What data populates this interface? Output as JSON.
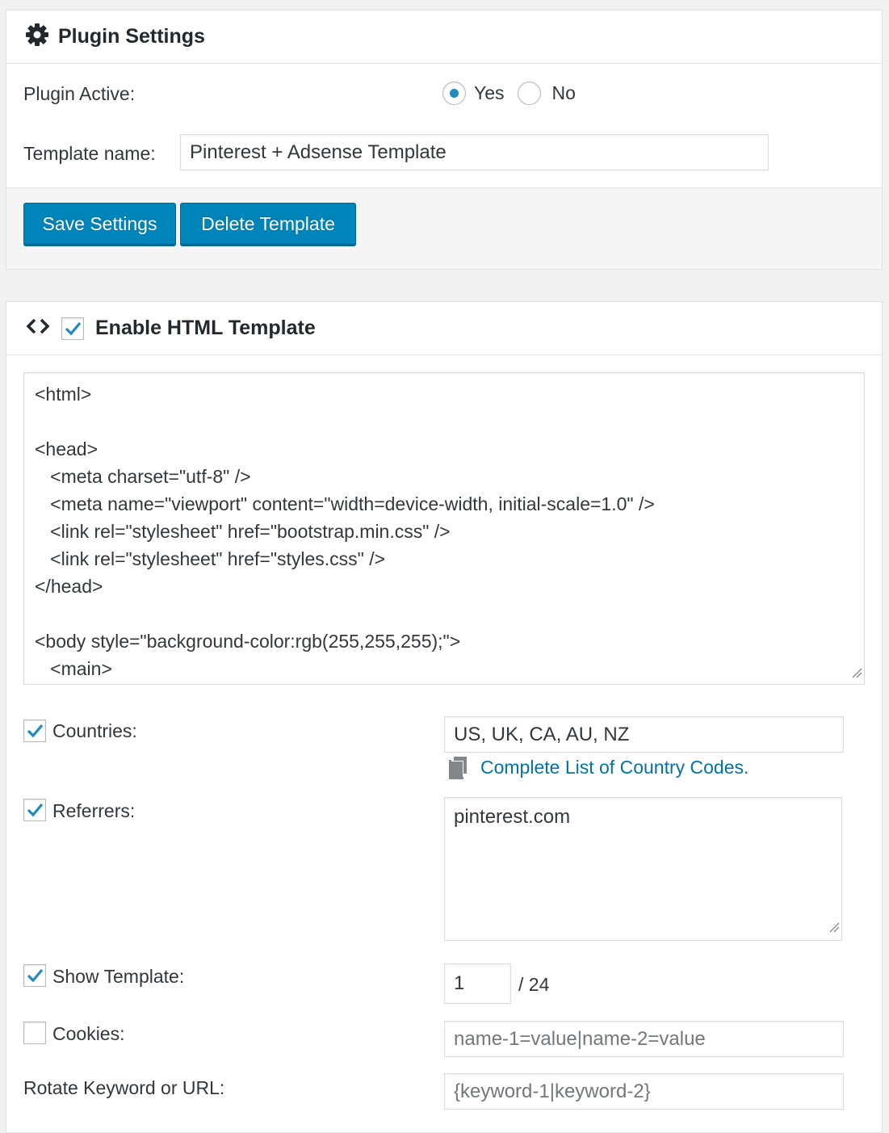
{
  "settings_panel": {
    "title": "Plugin Settings",
    "icon": "gear-icon",
    "plugin_active": {
      "label": "Plugin Active:",
      "options": [
        {
          "label": "Yes",
          "selected": true
        },
        {
          "label": "No",
          "selected": false
        }
      ]
    },
    "template_name": {
      "label": "Template name:",
      "value": "Pinterest + Adsense Template"
    },
    "buttons": {
      "save": "Save Settings",
      "delete": "Delete Template"
    }
  },
  "template_panel": {
    "icon": "code-icon",
    "enable_checked": true,
    "title": "Enable HTML Template",
    "code_lines": [
      "<html>",
      "",
      "<head>",
      "   <meta charset=\"utf-8\" />",
      "   <meta name=\"viewport\" content=\"width=device-width, initial-scale=1.0\" />",
      "   <link rel=\"stylesheet\" href=\"bootstrap.min.css\" />",
      "   <link rel=\"stylesheet\" href=\"styles.css\" />",
      "</head>",
      "",
      "<body style=\"background-color:rgb(255,255,255);\">",
      "   <main>"
    ],
    "countries": {
      "checked": true,
      "label": "Countries:",
      "value": "US, UK, CA, AU, NZ",
      "link_icon": "copy-icon",
      "link_text": "Complete List of Country Codes."
    },
    "referrers": {
      "checked": true,
      "label": "Referrers:",
      "value": "pinterest.com"
    },
    "show_template": {
      "checked": true,
      "label": "Show Template:",
      "value": "1",
      "suffix": "/ 24"
    },
    "cookies": {
      "checked": false,
      "label": "Cookies:",
      "placeholder": "name-1=value|name-2=value"
    },
    "rotate": {
      "label": "Rotate Keyword or URL:",
      "placeholder": "{keyword-1|keyword-2}"
    }
  },
  "colors": {
    "accent": "#0085ba",
    "link": "#0073aa",
    "background": "#f1f1f1"
  }
}
